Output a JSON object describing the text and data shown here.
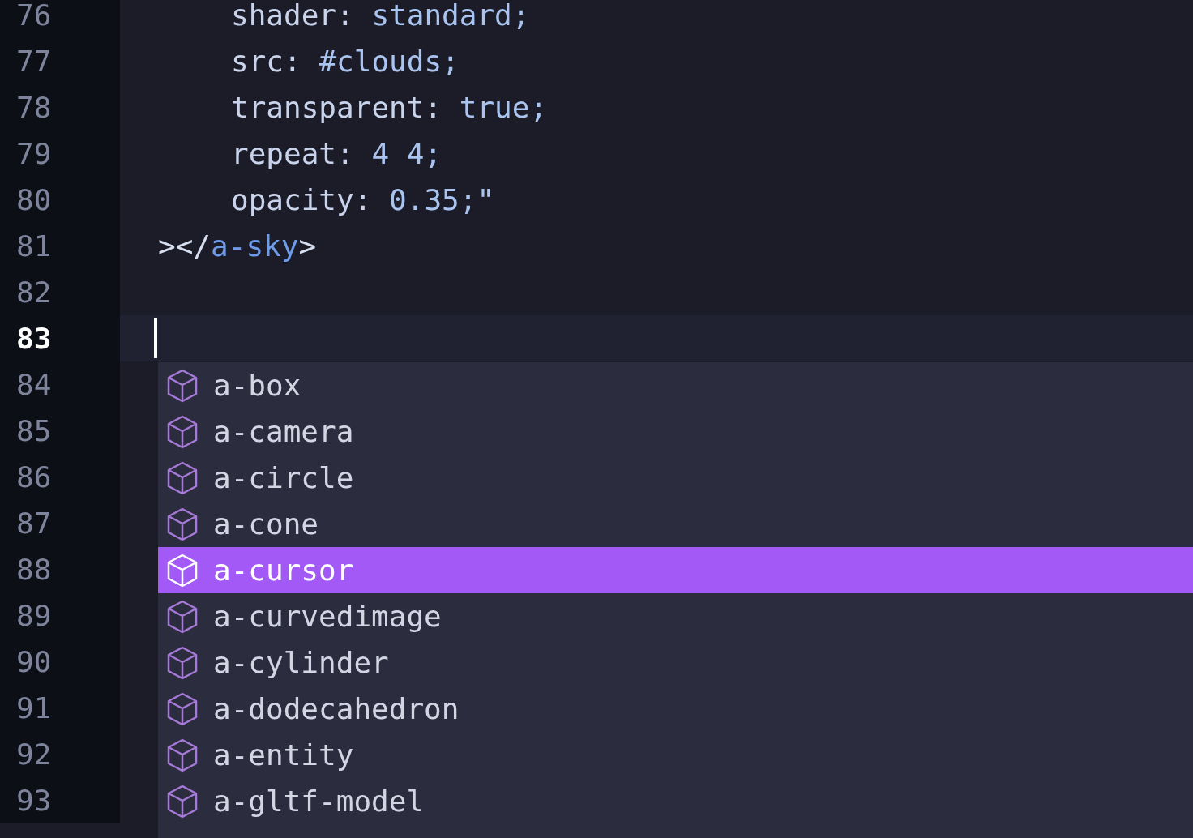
{
  "lines": [
    {
      "number": "76",
      "kind": "declaration",
      "current": false,
      "tokens": [
        {
          "kind": "prop",
          "text": "shader:"
        },
        {
          "kind": "value",
          "text": " standard;"
        }
      ]
    },
    {
      "number": "77",
      "kind": "declaration",
      "current": false,
      "tokens": [
        {
          "kind": "prop",
          "text": "src:"
        },
        {
          "kind": "value",
          "text": " #clouds;"
        }
      ]
    },
    {
      "number": "78",
      "kind": "declaration",
      "current": false,
      "tokens": [
        {
          "kind": "prop",
          "text": "transparent:"
        },
        {
          "kind": "value",
          "text": " true;"
        }
      ]
    },
    {
      "number": "79",
      "kind": "declaration",
      "current": false,
      "tokens": [
        {
          "kind": "prop",
          "text": "repeat:"
        },
        {
          "kind": "value",
          "text": " 4 4;"
        }
      ]
    },
    {
      "number": "80",
      "kind": "declaration",
      "current": false,
      "tokens": [
        {
          "kind": "prop",
          "text": "opacity:"
        },
        {
          "kind": "value",
          "text": " 0.35;\""
        }
      ]
    },
    {
      "number": "81",
      "kind": "tag",
      "current": false,
      "tokens": [
        {
          "kind": "punct",
          "text": "></"
        },
        {
          "kind": "tag",
          "text": "a-sky"
        },
        {
          "kind": "punct",
          "text": ">"
        }
      ]
    },
    {
      "number": "82",
      "kind": "blank",
      "current": false
    },
    {
      "number": "83",
      "kind": "blank",
      "current": true
    },
    {
      "number": "84",
      "kind": "blank",
      "current": false
    },
    {
      "number": "85",
      "kind": "blank",
      "current": false
    },
    {
      "number": "86",
      "kind": "blank",
      "current": false
    },
    {
      "number": "87",
      "kind": "blank",
      "current": false
    },
    {
      "number": "88",
      "kind": "blank",
      "current": false
    },
    {
      "number": "89",
      "kind": "blank",
      "current": false
    },
    {
      "number": "90",
      "kind": "blank",
      "current": false
    },
    {
      "number": "91",
      "kind": "blank",
      "current": false
    },
    {
      "number": "92",
      "kind": "blank",
      "current": false
    },
    {
      "number": "93",
      "kind": "blank",
      "current": false
    }
  ],
  "suggestions": [
    {
      "label": "a-box",
      "selected": false
    },
    {
      "label": "a-camera",
      "selected": false
    },
    {
      "label": "a-circle",
      "selected": false
    },
    {
      "label": "a-cone",
      "selected": false
    },
    {
      "label": "a-cursor",
      "selected": true
    },
    {
      "label": "a-curvedimage",
      "selected": false
    },
    {
      "label": "a-cylinder",
      "selected": false
    },
    {
      "label": "a-dodecahedron",
      "selected": false
    },
    {
      "label": "a-entity",
      "selected": false
    },
    {
      "label": "a-gltf-model",
      "selected": false
    }
  ]
}
